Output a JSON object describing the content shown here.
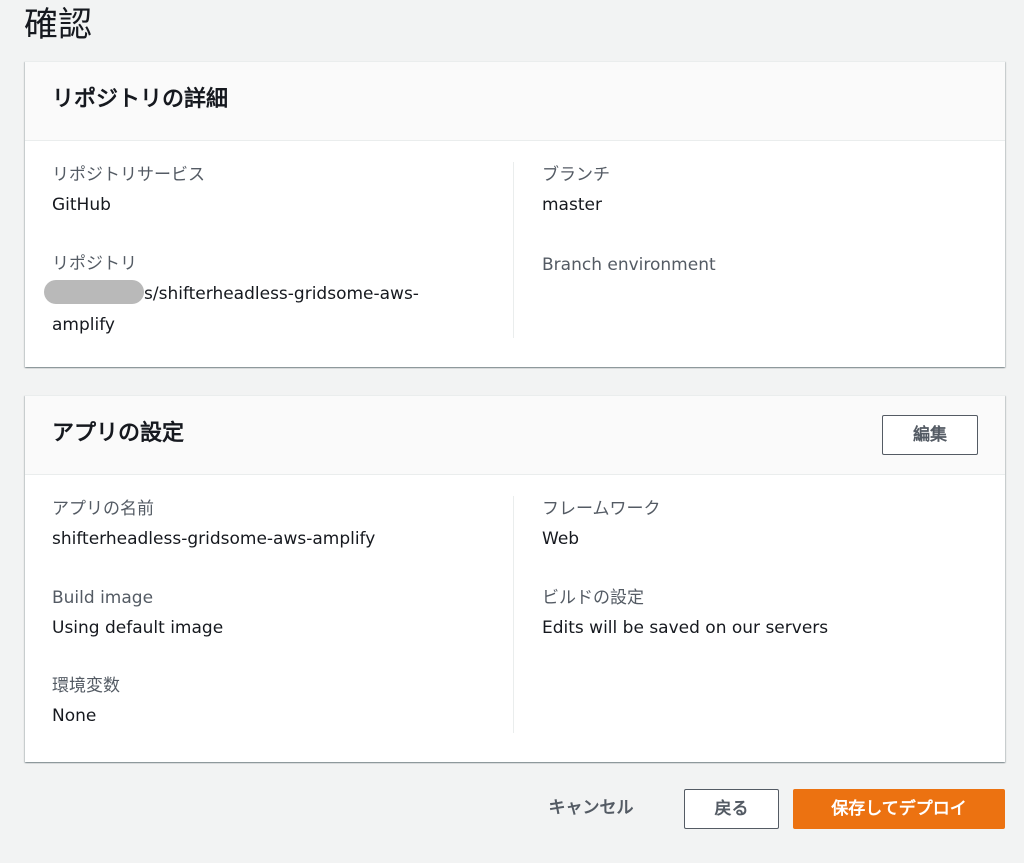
{
  "page": {
    "title": "確認"
  },
  "repo_panel": {
    "title": "リポジトリの詳細",
    "repo_service_label": "リポジトリサービス",
    "repo_service_value": "GitHub",
    "repo_label": "リポジトリ",
    "repo_value_line1": "s/shifterheadless-gridsome-aws-",
    "repo_value_line2": "amplify",
    "branch_label": "ブランチ",
    "branch_value": "master",
    "branch_env_label": "Branch environment"
  },
  "app_panel": {
    "title": "アプリの設定",
    "edit_label": "編集",
    "app_name_label": "アプリの名前",
    "app_name_value": "shifterheadless-gridsome-aws-amplify",
    "build_image_label": "Build image",
    "build_image_value": "Using default image",
    "env_vars_label": "環境変数",
    "env_vars_value": "None",
    "framework_label": "フレームワーク",
    "framework_value": "Web",
    "build_settings_label": "ビルドの設定",
    "build_settings_value": "Edits will be saved on our servers"
  },
  "footer": {
    "cancel_label": "キャンセル",
    "back_label": "戻る",
    "deploy_label": "保存してデプロイ"
  },
  "colors": {
    "primary": "#ec7211",
    "background": "#f2f3f3",
    "label": "#545b64",
    "text": "#16191f"
  }
}
